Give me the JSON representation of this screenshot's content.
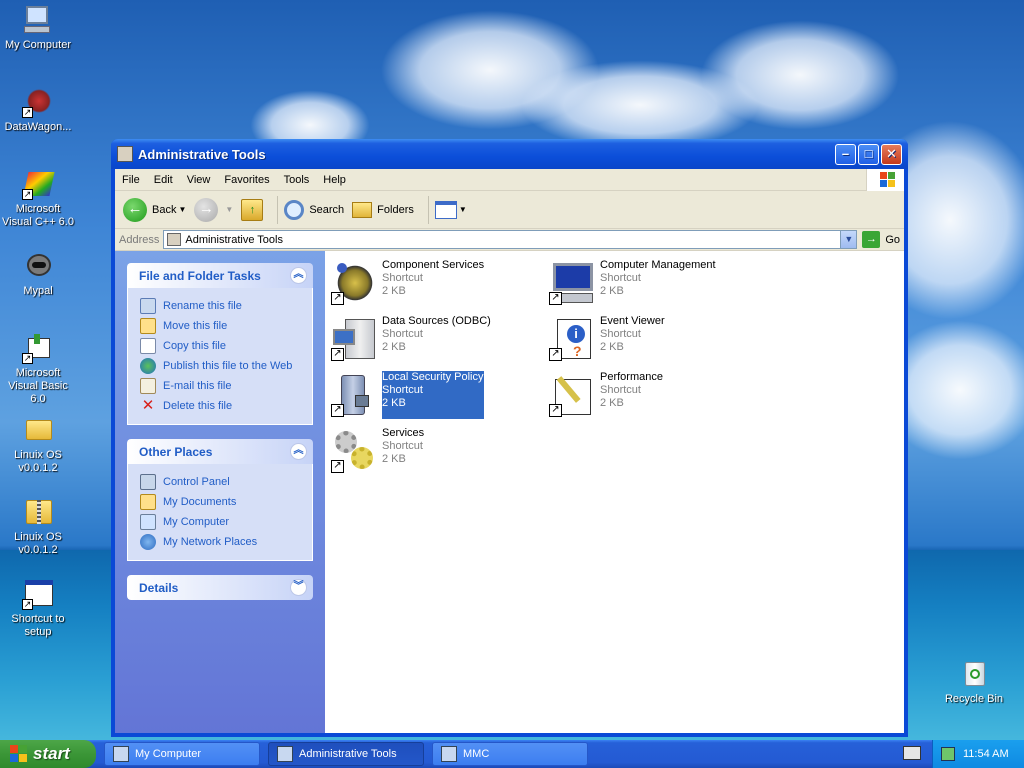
{
  "desktop": {
    "icons": [
      {
        "label": "My Computer",
        "icon": "my-computer-icon"
      },
      {
        "label": "DataWagon...",
        "icon": "datawagon-icon"
      },
      {
        "label": "Microsoft Visual C++ 6.0",
        "icon": "visual-cpp-icon"
      },
      {
        "label": "Mypal",
        "icon": "mypal-icon"
      },
      {
        "label": "Microsoft Visual Basic 6.0",
        "icon": "visual-basic-icon"
      },
      {
        "label": "Linuix OS v0.0.1.2",
        "icon": "folder-icon"
      },
      {
        "label": "Linuix OS v0.0.1.2",
        "icon": "zip-folder-icon"
      },
      {
        "label": "Shortcut to setup",
        "icon": "setup-shortcut-icon"
      },
      {
        "label": "Recycle Bin",
        "icon": "recycle-bin-icon"
      }
    ]
  },
  "window": {
    "title": "Administrative Tools",
    "menu": [
      "File",
      "Edit",
      "View",
      "Favorites",
      "Tools",
      "Help"
    ],
    "toolbar": {
      "back": "Back",
      "search": "Search",
      "folders": "Folders"
    },
    "address": {
      "label": "Address",
      "value": "Administrative Tools",
      "go": "Go"
    }
  },
  "taskpane": {
    "file_tasks": {
      "title": "File and Folder Tasks",
      "items": [
        "Rename this file",
        "Move this file",
        "Copy this file",
        "Publish this file to the Web",
        "E-mail this file",
        "Delete this file"
      ]
    },
    "other_places": {
      "title": "Other Places",
      "items": [
        "Control Panel",
        "My Documents",
        "My Computer",
        "My Network Places"
      ]
    },
    "details": {
      "title": "Details"
    }
  },
  "files": [
    {
      "name": "Component Services",
      "type": "Shortcut",
      "size": "2 KB",
      "icon": "component-services-icon",
      "selected": false
    },
    {
      "name": "Computer Management",
      "type": "Shortcut",
      "size": "2 KB",
      "icon": "computer-management-icon",
      "selected": false
    },
    {
      "name": "Data Sources (ODBC)",
      "type": "Shortcut",
      "size": "2 KB",
      "icon": "data-sources-icon",
      "selected": false
    },
    {
      "name": "Event Viewer",
      "type": "Shortcut",
      "size": "2 KB",
      "icon": "event-viewer-icon",
      "selected": false
    },
    {
      "name": "Local Security Policy",
      "type": "Shortcut",
      "size": "2 KB",
      "icon": "local-security-policy-icon",
      "selected": true
    },
    {
      "name": "Performance",
      "type": "Shortcut",
      "size": "2 KB",
      "icon": "performance-icon",
      "selected": false
    },
    {
      "name": "Services",
      "type": "Shortcut",
      "size": "2 KB",
      "icon": "services-icon",
      "selected": false
    }
  ],
  "taskbar": {
    "start": "start",
    "buttons": [
      {
        "label": "My Computer",
        "active": false
      },
      {
        "label": "Administrative Tools",
        "active": true
      },
      {
        "label": "MMC",
        "active": false
      }
    ],
    "clock": "11:54 AM"
  }
}
